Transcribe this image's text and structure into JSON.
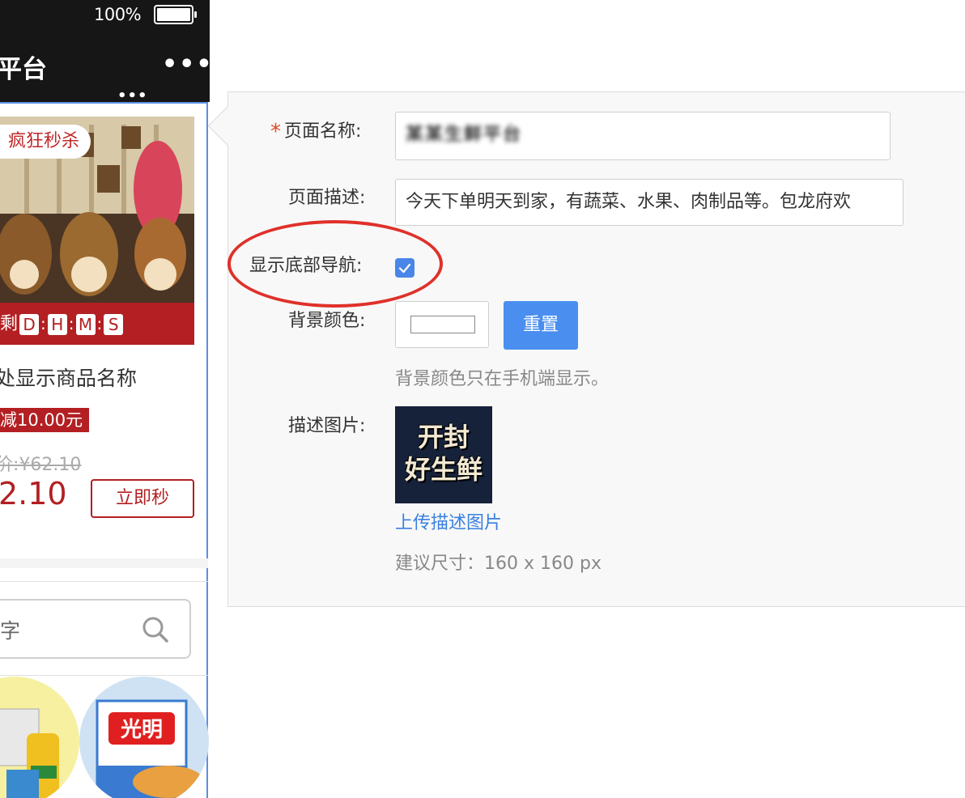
{
  "phone": {
    "battery_percent": "100%",
    "nav_title": "平台",
    "nav_more": "•••",
    "nav_dots_small": "•••",
    "product": {
      "flash_badge": "疯狂秒杀",
      "countdown_prefix": "仅剩",
      "countdown_units": [
        "D",
        "H",
        "M",
        "S"
      ],
      "name": "处显示商品名称",
      "discount": "减10.00元",
      "original_price": "价:¥62.10",
      "sale_price": "2.10",
      "buy_button": "立即秒"
    },
    "search": {
      "placeholder": "字"
    },
    "categories": [
      {
        "icon": "cooking-oil-rice-icon",
        "bg": "#f6f0a0"
      },
      {
        "icon": "guangming-milk-bread-icon",
        "bg": "#cfe2f3",
        "brand_text": "光明"
      }
    ]
  },
  "form": {
    "page_name": {
      "label": "页面名称:",
      "required_mark": "*",
      "value": "某某生鲜平台"
    },
    "page_desc": {
      "label": "页面描述:",
      "value": "今天下单明天到家，有蔬菜、水果、肉制品等。包龙府欢"
    },
    "show_bottom_nav": {
      "label": "显示底部导航:",
      "checked": true
    },
    "bg_color": {
      "label": "背景颜色:",
      "value": "#ffffff",
      "reset_button": "重置",
      "hint": "背景颜色只在手机端显示。"
    },
    "desc_image": {
      "label": "描述图片:",
      "image_text_line1": "开封",
      "image_text_line2": "好生鲜",
      "upload_link": "上传描述图片",
      "size_hint": "建议尺寸：160 x 160 px"
    }
  },
  "colors": {
    "accent_blue": "#4a8ef0",
    "brand_red": "#b31f22",
    "annotation_red": "#e0302a"
  }
}
